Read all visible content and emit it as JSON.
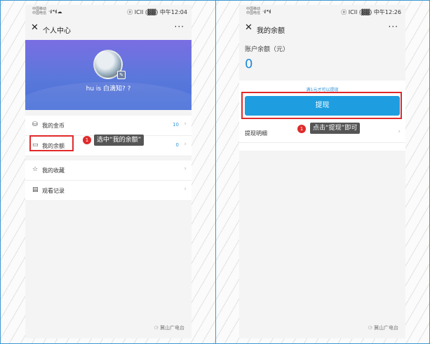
{
  "left": {
    "status": {
      "carrier_top": "中国移动",
      "carrier_bottom": "中国电信",
      "signal": "᛫ıl ⁴ᴳıl ☁",
      "right": "ⓞ ICIl (▓▓) 中午12:04"
    },
    "title": "个人中心",
    "close_glyph": "✕",
    "more_glyph": "···",
    "username": "hu is 白滴知? ?",
    "menu1": [
      {
        "icon": "⛁",
        "label": "我的金币",
        "value": "10",
        "chev": "›"
      },
      {
        "icon": "▭",
        "label": "我的余额",
        "value": "0",
        "chev": "›"
      }
    ],
    "menu2": [
      {
        "icon": "☆",
        "label": "我的收藏",
        "chev": "›"
      },
      {
        "icon": "▤",
        "label": "观看记录",
        "chev": "›"
      }
    ],
    "step_number": "1",
    "tip": "选中“我的余额”",
    "watermark": "⚆ 冀山广电台"
  },
  "right": {
    "status": {
      "carrier_top": "中国移动",
      "carrier_bottom": "中国电信",
      "signal": "᛫ıl ⁴ᴳıl",
      "right": "ⓞ ICIl (▓▓) 中午12:26"
    },
    "title": "我的余额",
    "close_glyph": "✕",
    "more_glyph": "···",
    "balance_label": "账户余额（元）",
    "balance_value": "0",
    "min_note": "满1元才可以提现",
    "withdraw_label": "提现",
    "detail_label": "提现明细",
    "detail_chev": "›",
    "step_number": "1",
    "tip": "点击“提现”即可",
    "watermark": "⚆ 冀山广电台"
  },
  "colors": {
    "accent": "#1e9ee0",
    "highlight": "#e02a2a",
    "banner": "#5a78db"
  }
}
